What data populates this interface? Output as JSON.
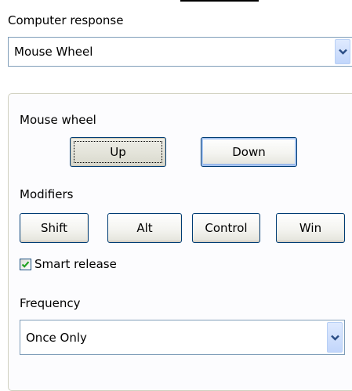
{
  "computer_response": {
    "label": "Computer response",
    "selected": "Mouse Wheel"
  },
  "mouse_wheel": {
    "label": "Mouse wheel",
    "up_label": "Up",
    "down_label": "Down"
  },
  "modifiers": {
    "label": "Modifiers",
    "shift_label": "Shift",
    "alt_label": "Alt",
    "control_label": "Control",
    "win_label": "Win"
  },
  "smart_release": {
    "label": "Smart release",
    "checked": true
  },
  "frequency": {
    "label": "Frequency",
    "selected": "Once Only"
  },
  "icons": {
    "dropdown": "chevron-down-icon",
    "check": "checkmark-icon"
  },
  "colors": {
    "accent": "#2c4f86",
    "check": "#21a121",
    "border": "#7f9db9"
  }
}
